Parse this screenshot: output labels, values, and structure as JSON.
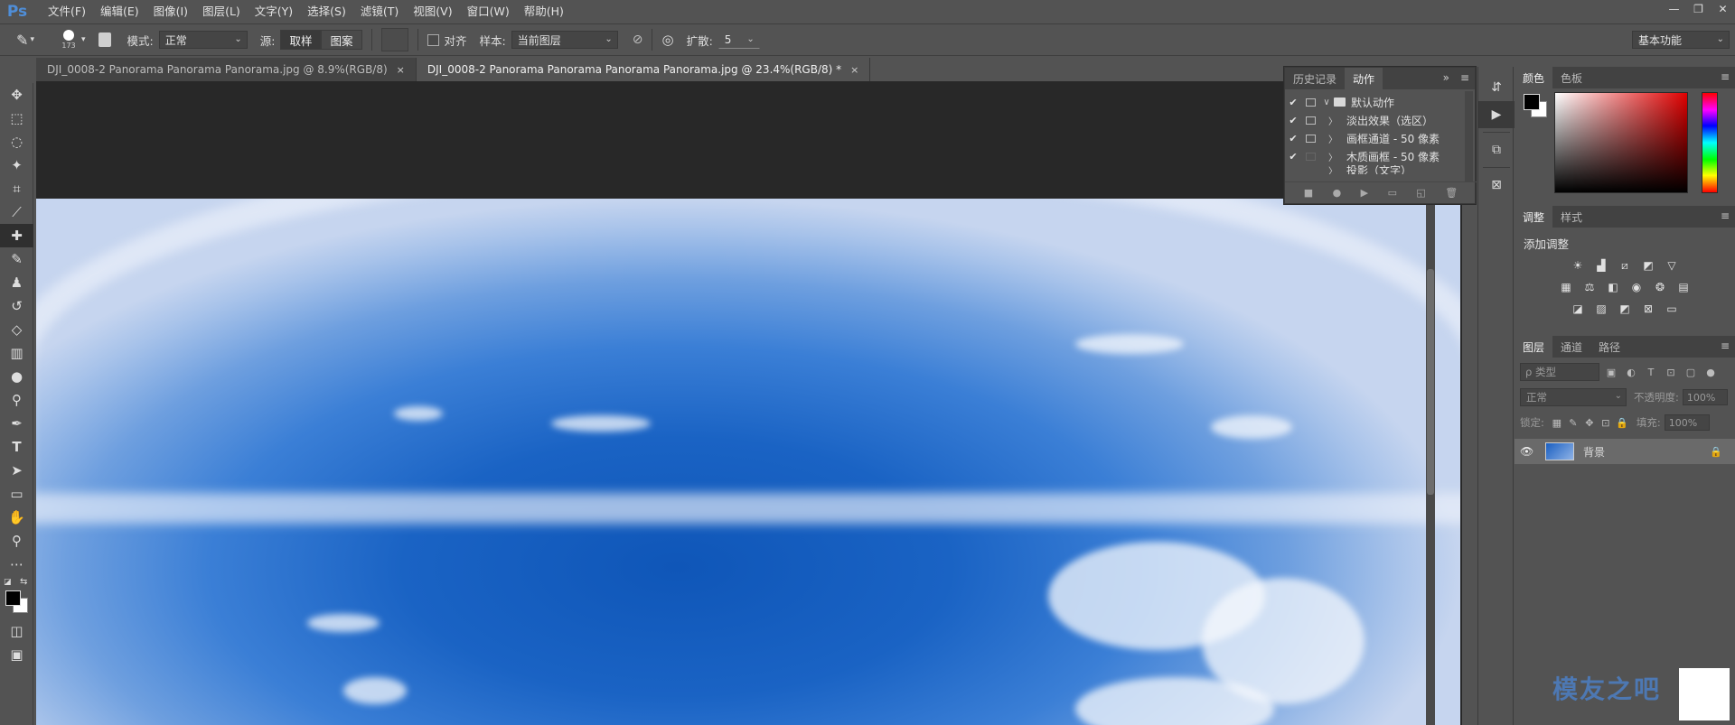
{
  "app": {
    "logo": "Ps"
  },
  "menu": [
    "文件(F)",
    "编辑(E)",
    "图像(I)",
    "图层(L)",
    "文字(Y)",
    "选择(S)",
    "滤镜(T)",
    "视图(V)",
    "窗口(W)",
    "帮助(H)"
  ],
  "window_controls": {
    "minimize": "—",
    "restore": "❐",
    "close": "✕"
  },
  "options": {
    "brush_size": "173",
    "mode_label": "模式:",
    "mode_value": "正常",
    "source_label": "源:",
    "source_sampled": "取样",
    "source_pattern": "图案",
    "aligned_label": "对齐",
    "sample_label": "样本:",
    "sample_value": "当前图层",
    "diffusion_label": "扩散:",
    "diffusion_value": "5",
    "workspace": "基本功能"
  },
  "doc_tabs": [
    {
      "label": "DJI_0008-2 Panorama Panorama Panorama.jpg @ 8.9%(RGB/8)",
      "close": "×",
      "active": false
    },
    {
      "label": "DJI_0008-2 Panorama Panorama Panorama Panorama.jpg @ 23.4%(RGB/8) *",
      "close": "×",
      "active": true
    }
  ],
  "actions_panel": {
    "tabs": [
      "历史记录",
      "动作"
    ],
    "expand": "»",
    "rows": [
      {
        "check": "✔",
        "toggle": "∨",
        "label": "默认动作",
        "folder": true
      },
      {
        "check": "✔",
        "toggle": "〉",
        "label": "淡出效果（选区）",
        "folder": false
      },
      {
        "check": "✔",
        "toggle": "〉",
        "label": "画框通道 - 50 像素",
        "folder": false
      },
      {
        "check": "✔",
        "toggle": "〉",
        "label": "木质画框 - 50 像素",
        "folder": false
      },
      {
        "check": "",
        "toggle": "〉",
        "label": "投影（文字）",
        "folder": false
      }
    ],
    "bottom": [
      "■",
      "●",
      "▶",
      "▭",
      "◱",
      "🗑"
    ]
  },
  "color_panel": {
    "tabs": [
      "颜色",
      "色板"
    ],
    "fg": "#000000",
    "bg": "#ffffff"
  },
  "adjust_panel": {
    "tabs": [
      "调整",
      "样式"
    ],
    "title": "添加调整"
  },
  "layers_panel": {
    "tabs": [
      "图层",
      "通道",
      "路径"
    ],
    "filter_placeholder": "ρ 类型",
    "blend_mode": "正常",
    "opacity_label": "不透明度:",
    "opacity_value": "100%",
    "lock_label": "锁定:",
    "fill_label": "填充:",
    "fill_value": "100%",
    "layer_name": "背景"
  },
  "watermark": "模友之吧"
}
